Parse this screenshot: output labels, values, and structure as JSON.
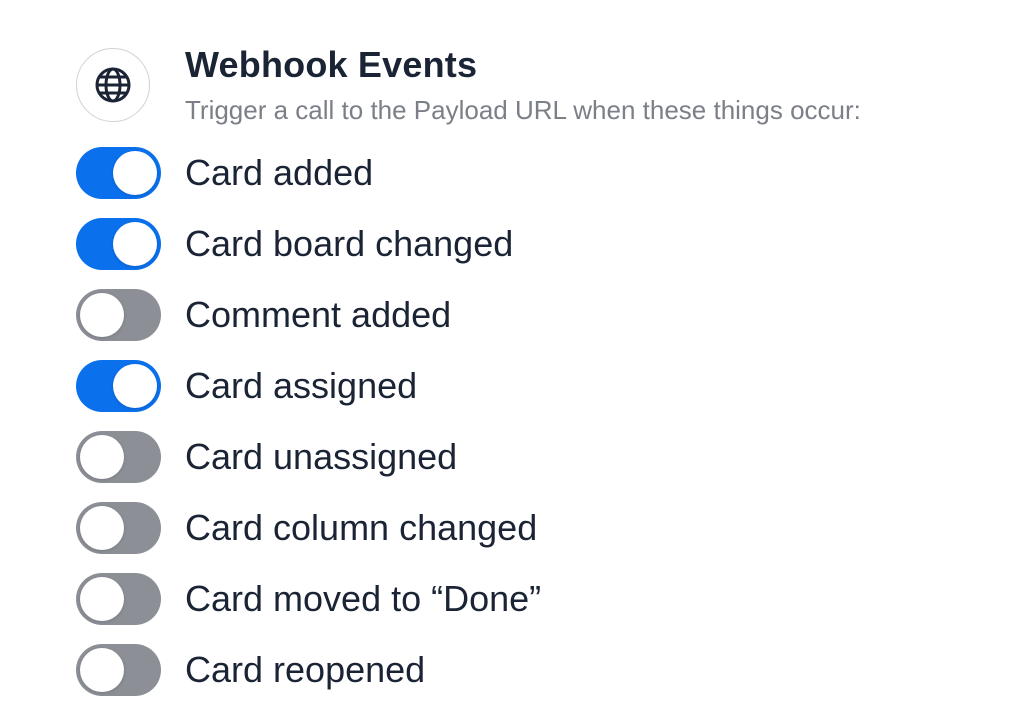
{
  "header": {
    "icon": "globe-icon",
    "title": "Webhook Events",
    "subtitle": "Trigger a call to the Payload URL when these things occur:"
  },
  "colors": {
    "toggle_on": "#0a70ec",
    "toggle_off": "#8c8f96",
    "text": "#1b2435",
    "subtitle": "#7b7f87"
  },
  "events": [
    {
      "label": "Card added",
      "enabled": true
    },
    {
      "label": "Card board changed",
      "enabled": true
    },
    {
      "label": "Comment added",
      "enabled": false
    },
    {
      "label": "Card assigned",
      "enabled": true
    },
    {
      "label": "Card unassigned",
      "enabled": false
    },
    {
      "label": "Card column changed",
      "enabled": false
    },
    {
      "label": "Card moved to “Done”",
      "enabled": false
    },
    {
      "label": "Card reopened",
      "enabled": false
    }
  ]
}
